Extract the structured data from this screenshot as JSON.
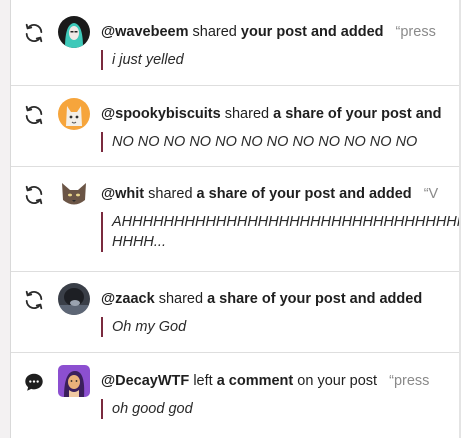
{
  "notifications": [
    {
      "type": "reblog",
      "icon": "reblog-icon",
      "avatar": "teal-hair-avatar",
      "username": "@wavebeem",
      "verb": "shared",
      "object": "your post and added",
      "quote": "“press",
      "content": "i just yelled"
    },
    {
      "type": "reblog",
      "icon": "reblog-icon",
      "avatar": "fox-avatar",
      "username": "@spookybiscuits",
      "verb": "shared",
      "object": "a share of your post and",
      "quote": "",
      "content": "NO NO NO NO NO NO NO NO NO NO NO NO"
    },
    {
      "type": "reblog",
      "icon": "reblog-icon",
      "avatar": "cat-avatar",
      "username": "@whit",
      "verb": "shared",
      "object": "a share of your post and added",
      "quote": "“V",
      "content_line1": "AHHHHHHHHHHHHHHHHHHHHHHHHHHHHHHHHHHHH",
      "content_line2": "HHHH..."
    },
    {
      "type": "reblog",
      "icon": "reblog-icon",
      "avatar": "dark-avatar",
      "username": "@zaack",
      "verb": "shared",
      "object": "a share of your post and added",
      "quote": "",
      "content": "Oh my God"
    },
    {
      "type": "comment",
      "icon": "comment-icon",
      "avatar": "purple-portrait-avatar",
      "username": "@DecayWTF",
      "verb": "left",
      "object": "a comment",
      "suffix": "on your post",
      "quote": "“press",
      "content": "oh good god"
    }
  ],
  "colors": {
    "accent_bar": "#7a2a3e",
    "muted_quote": "#8a8a8a"
  }
}
